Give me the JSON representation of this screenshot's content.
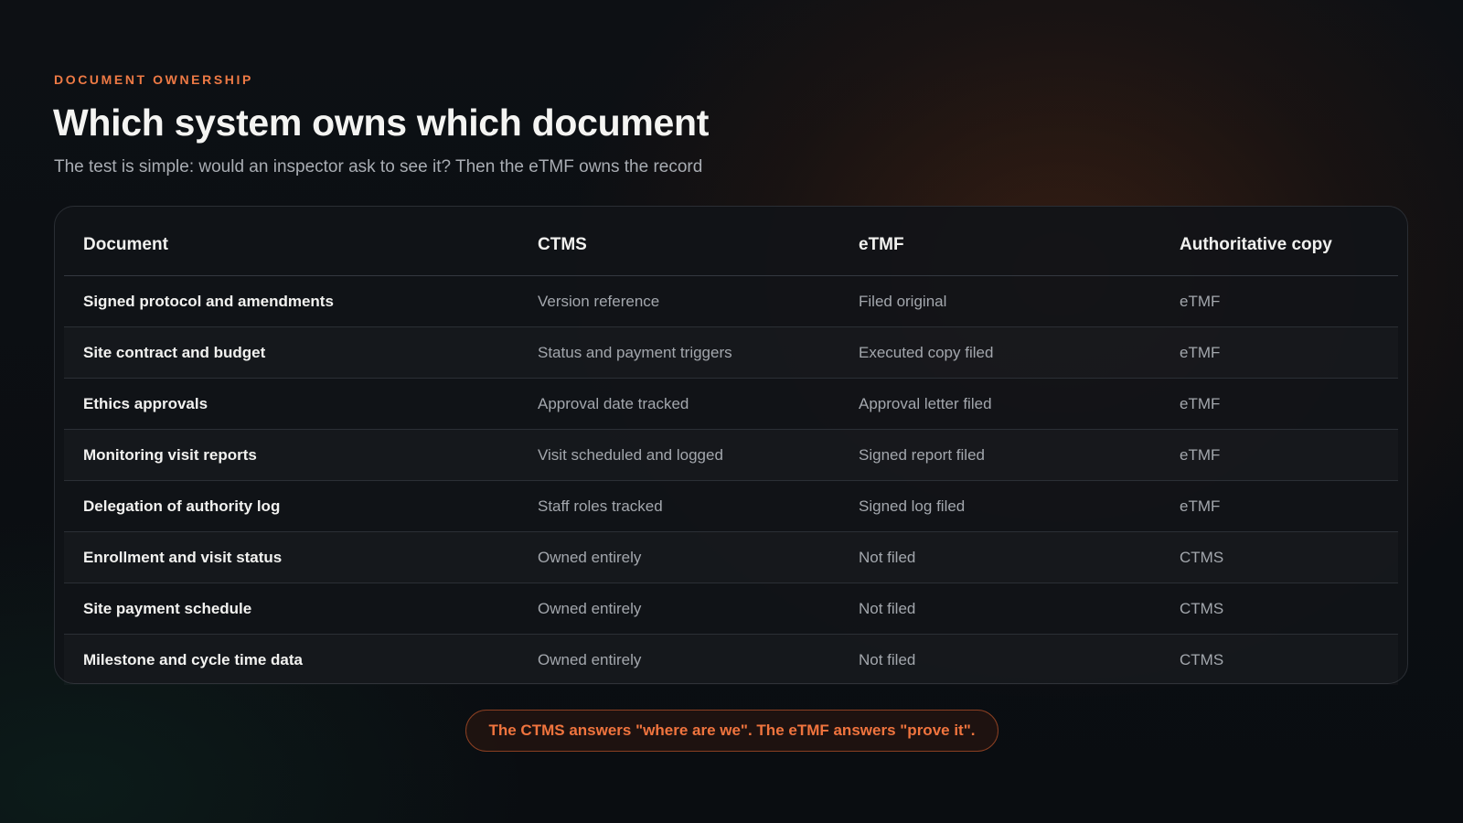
{
  "header": {
    "eyebrow": "DOCUMENT OWNERSHIP",
    "title": "Which system owns which document",
    "subtitle": "The test is simple: would an inspector ask to see it? Then the eTMF owns the record"
  },
  "table": {
    "columns": [
      "Document",
      "CTMS",
      "eTMF",
      "Authoritative copy"
    ],
    "rows": [
      {
        "document": "Signed protocol and amendments",
        "ctms": "Version reference",
        "etmf": "Filed original",
        "authoritative": "eTMF"
      },
      {
        "document": "Site contract and budget",
        "ctms": "Status and payment triggers",
        "etmf": "Executed copy filed",
        "authoritative": "eTMF"
      },
      {
        "document": "Ethics approvals",
        "ctms": "Approval date tracked",
        "etmf": "Approval letter filed",
        "authoritative": "eTMF"
      },
      {
        "document": "Monitoring visit reports",
        "ctms": "Visit scheduled and logged",
        "etmf": "Signed report filed",
        "authoritative": "eTMF"
      },
      {
        "document": "Delegation of authority log",
        "ctms": "Staff roles tracked",
        "etmf": "Signed log filed",
        "authoritative": "eTMF"
      },
      {
        "document": "Enrollment and visit status",
        "ctms": "Owned entirely",
        "etmf": "Not filed",
        "authoritative": "CTMS"
      },
      {
        "document": "Site payment schedule",
        "ctms": "Owned entirely",
        "etmf": "Not filed",
        "authoritative": "CTMS"
      },
      {
        "document": "Milestone and cycle time data",
        "ctms": "Owned entirely",
        "etmf": "Not filed",
        "authoritative": "CTMS"
      }
    ]
  },
  "callout": {
    "text": "The CTMS answers \"where are we\". The eTMF answers \"prove it\"."
  },
  "colors": {
    "accent": "#ee7a45",
    "background": "#0b0e12",
    "card": "#111418"
  }
}
